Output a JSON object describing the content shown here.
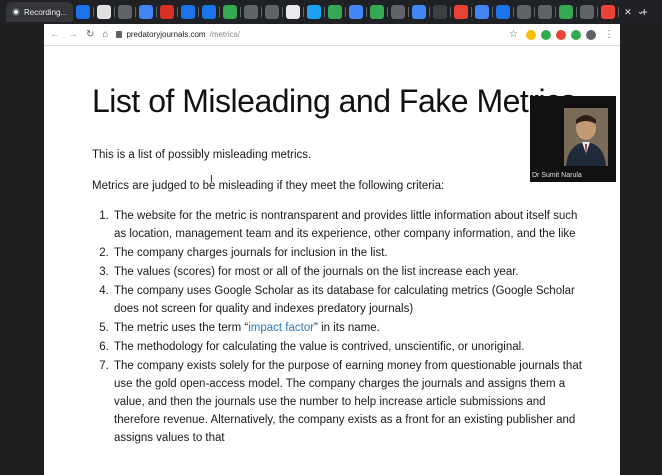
{
  "browser": {
    "active_tab_label": "Recording...",
    "address": {
      "host": "predatoryjournals.com",
      "path": "/metrics/"
    },
    "tab_colors": [
      "#1a73e8",
      "#e0e0e0",
      "#5f6368",
      "#4285f4",
      "#d93025",
      "#1a73e8",
      "#1a73e8",
      "#34a853",
      "#5f6368",
      "#5f6368",
      "#e8eaed",
      "#1da1f2",
      "#34a853",
      "#4285f4",
      "#34a853",
      "#5f6368",
      "#4285f4",
      "#3c4043",
      "#ea4335",
      "#4285f4",
      "#1a73e8",
      "#5f6368",
      "#5f6368",
      "#34a853",
      "#5f6368",
      "#ea4335"
    ],
    "ext_colors": [
      "#fbbc05",
      "#34a853",
      "#ea4335",
      "#34a853",
      "#5f6368"
    ]
  },
  "page": {
    "title": "List of Misleading and Fake Metrics",
    "intro": "This is a list of possibly misleading metrics.",
    "criteria_intro": "Metrics are judged to be misleading if they meet the following criteria:",
    "criteria": [
      {
        "text": "The website for the metric is nontransparent and provides little information about itself such as location, management team and its experience, other company information, and the like"
      },
      {
        "text": "The company charges journals for inclusion in the list."
      },
      {
        "text": "The values (scores) for most or all of the journals on the list increase each year."
      },
      {
        "text": "The company uses Google Scholar as its database for calculating metrics (Google Scholar does not screen for quality and indexes predatory journals)"
      },
      {
        "before": "The metric uses the term “",
        "link": "impact factor",
        "after": "” in its name."
      },
      {
        "text": "The methodology for calculating the value is contrived, unscientific, or unoriginal."
      },
      {
        "text": "The company exists solely for the purpose of earning money from questionable journals that use the gold open-access model. The company charges the journals and assigns them a value, and then the journals use the number to help increase article submissions and therefore revenue. Alternatively, the company exists as a front for an existing publisher and assigns values to that"
      }
    ]
  },
  "webcam": {
    "caption": "Dr Sumit Narula"
  }
}
